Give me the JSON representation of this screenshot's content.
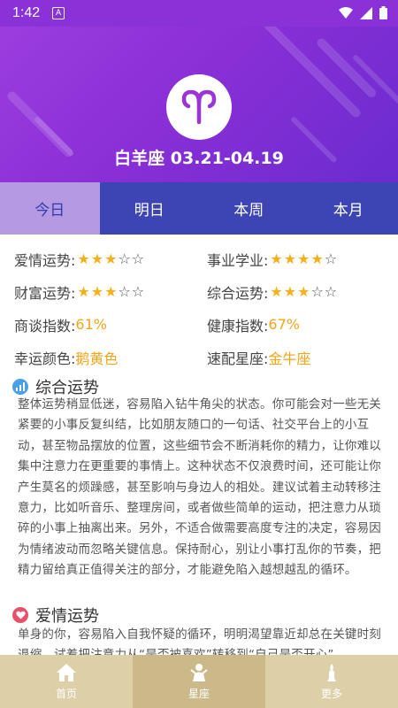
{
  "status_bar": {
    "time": "1:42",
    "a_badge": "A"
  },
  "header": {
    "title": "白羊座 03.21-04.19",
    "logo_icon": "aries-icon"
  },
  "tabs": [
    {
      "label": "今日",
      "active": true
    },
    {
      "label": "明日",
      "active": false
    },
    {
      "label": "本周",
      "active": false
    },
    {
      "label": "本月",
      "active": false
    }
  ],
  "attributes": {
    "love": {
      "label": "爱情运势:",
      "stars": 3,
      "max": 5
    },
    "career": {
      "label": "事业学业:",
      "stars": 4,
      "max": 5
    },
    "wealth": {
      "label": "财富运势:",
      "stars": 3,
      "max": 5
    },
    "overall": {
      "label": "综合运势:",
      "stars": 3,
      "max": 5
    },
    "negotiation": {
      "label": "商谈指数:",
      "value": "61%"
    },
    "health": {
      "label": "健康指数:",
      "value": "67%"
    },
    "lucky_color": {
      "label": "幸运颜色:",
      "value": "鹅黄色"
    },
    "match": {
      "label": "速配星座:",
      "value": "金牛座"
    }
  },
  "sections": {
    "overall": {
      "title": "综合运势",
      "text": "整体运势稍显低迷，容易陷入钻牛角尖的状态。你可能会对一些无关紧要的小事反复纠结，比如朋友随口的一句话、社交平台上的小互动，甚至物品摆放的位置，这些细节会不断消耗你的精力，让你难以集中注意力在更重要的事情上。这种状态不仅浪费时间，还可能让你产生莫名的烦躁感，甚至影响与身边人的相处。建议试着主动转移注意力，比如听音乐、整理房间，或者做些简单的运动，把注意力从琐碎的小事上抽离出来。另外，不适合做需要高度专注的决定，容易因为情绪波动而忽略关键信息。保持耐心，别让小事打乱你的节奏，把精力留给真正值得关注的部分，才能避免陷入越想越乱的循环。"
    },
    "love": {
      "title": "爱情运势",
      "text": "单身的你，容易陷入自我怀疑的循环，明明渴望靠近却总在关键时刻退缩，试着把注意力从“是否被喜欢”转移到“自己是否开心”"
    }
  },
  "bottom_nav": [
    {
      "label": "首页",
      "icon": "home-icon",
      "active": false
    },
    {
      "label": "星座",
      "icon": "constellation-icon",
      "active": true
    },
    {
      "label": "更多",
      "icon": "more-icon",
      "active": false
    }
  ],
  "colors": {
    "header": "#8a32d8",
    "tab_bar": "#3d44b4",
    "tab_active": "#b59ae2",
    "accent": "#f0a51a",
    "nav": "#ddcfa8"
  }
}
